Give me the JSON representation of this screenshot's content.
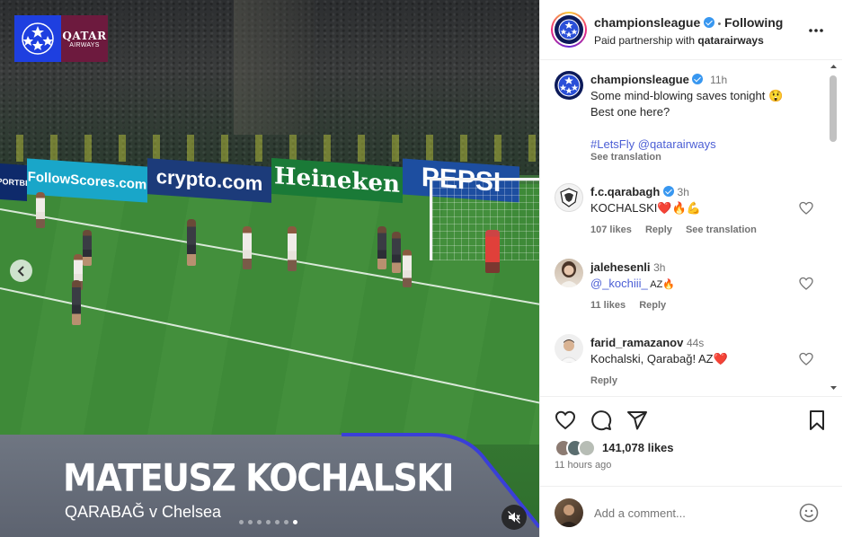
{
  "media": {
    "adboards": [
      "FollowScores.com",
      "crypto.com",
      "Heineken",
      "PEPSI"
    ],
    "adboard_left": "SPORTBET",
    "sponsor_logo": {
      "line1": "QATAR",
      "line2": "AIRWAYS"
    },
    "player_name": "MATEUSZ KOCHALSKI",
    "match_title": "QARABAĞ v Chelsea",
    "carousel": {
      "count": 7,
      "active_index": 6
    },
    "icons": {
      "previous": "chevron-left-icon",
      "mute": "speaker-muted-icon"
    }
  },
  "header": {
    "username": "championsleague",
    "separator": "•",
    "follow_state": "Following",
    "partnership_prefix": "Paid partnership with",
    "partner": "qatarairways",
    "more_icon": "more-horizontal-icon"
  },
  "caption": {
    "username": "championsleague",
    "time": "11h",
    "line1": "Some mind-blowing saves tonight 😲",
    "line2": "Best one here?",
    "hashtags": "#LetsFly @qatarairways",
    "see_translation": "See translation"
  },
  "comments": [
    {
      "username": "f.c.qarabagh",
      "verified": true,
      "time": "3h",
      "text": "KOCHALSKI❤️🔥💪",
      "likes": "107 likes",
      "reply": "Reply",
      "see_translation": "See translation"
    },
    {
      "username": "jalehesenli",
      "verified": false,
      "time": "3h",
      "mention": "@_kochiii_",
      "text": " AZ🔥",
      "likes": "11 likes",
      "reply": "Reply"
    },
    {
      "username": "farid_ramazanov",
      "verified": false,
      "time": "44s",
      "text": "Kochalski, Qarabağ! AZ❤️",
      "reply": "Reply"
    }
  ],
  "actions": {
    "likes": "141,078 likes",
    "time_ago": "11 hours ago",
    "icons": [
      "heart-icon",
      "comment-icon",
      "share-icon",
      "bookmark-icon"
    ]
  },
  "add_comment": {
    "placeholder": "Add a comment...",
    "emoji_icon": "emoji-icon"
  },
  "colors": {
    "link": "#4c5fd5",
    "verified": "#3897f0",
    "like_heart": "#ed4956",
    "ucl_blue": "#1e3fe0",
    "qatar_maroon": "#6d1a3e"
  }
}
